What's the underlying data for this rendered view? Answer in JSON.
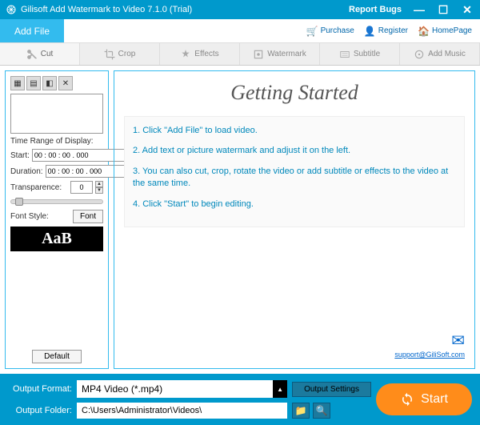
{
  "titlebar": {
    "title": "Gilisoft Add Watermark to Video 7.1.0 (Trial)",
    "report": "Report Bugs"
  },
  "topbar": {
    "add_file": "Add File",
    "purchase": "Purchase",
    "register": "Register",
    "homepage": "HomePage"
  },
  "tabs": {
    "cut": "Cut",
    "crop": "Crop",
    "effects": "Effects",
    "watermark": "Watermark",
    "subtitle": "Subtitle",
    "add_music": "Add Music"
  },
  "sidebar": {
    "time_range_label": "Time Range of Display:",
    "start_label": "Start:",
    "start_value": "00 : 00 : 00 . 000",
    "duration_label": "Duration:",
    "duration_value": "00 : 00 : 00 . 000",
    "transparence_label": "Transparence:",
    "transparence_value": "0",
    "font_style_label": "Font Style:",
    "font_btn": "Font",
    "font_preview": "AaB",
    "default_btn": "Default"
  },
  "main": {
    "heading": "Getting Started",
    "step1": "1. Click \"Add File\" to load video.",
    "step2": "2. Add text or picture watermark and adjust it on the left.",
    "step3": "3. You can also cut, crop, rotate the video or add subtitle or effects to the video at the same time.",
    "step4": "4. Click \"Start\" to begin editing.",
    "support_email": "support@GiliSoft.com"
  },
  "bottom": {
    "format_label": "Output Format:",
    "format_value": "MP4 Video (*.mp4)",
    "output_settings": "Output Settings",
    "folder_label": "Output Folder:",
    "folder_value": "C:\\Users\\Administrator\\Videos\\",
    "start": "Start"
  }
}
